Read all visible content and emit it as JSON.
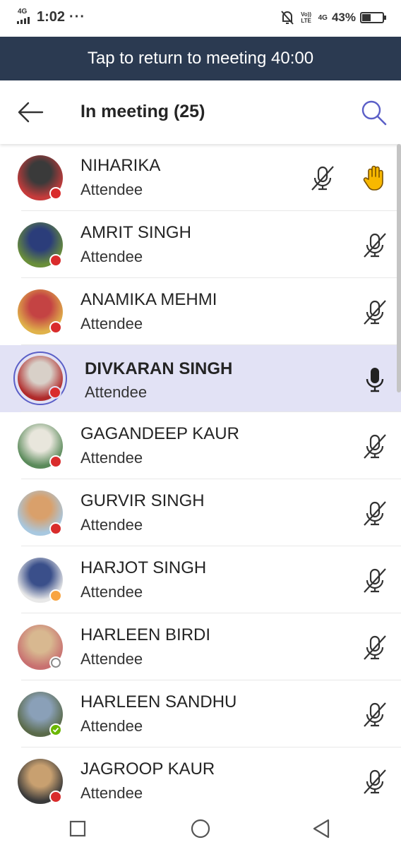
{
  "status_bar": {
    "network": "4G",
    "time": "1:02",
    "more": "···",
    "volte": "Vo)) LTE",
    "net2": "4G",
    "battery_pct": "43%",
    "battery_level": 0.43,
    "icons": [
      "mute-bell-icon",
      "signal-icon",
      "battery-icon"
    ]
  },
  "banner": {
    "text": "Tap to return to meeting 40:00"
  },
  "header": {
    "title": "In meeting (25)",
    "back_icon": "arrow-left-icon",
    "search_icon": "search-icon"
  },
  "participants": [
    {
      "name": "NIHARIKA",
      "role": "Attendee",
      "status": "busy",
      "mic": "muted",
      "raised_hand": true,
      "avatar_colors": [
        "#3a3a3a",
        "#c63b3b"
      ]
    },
    {
      "name": "AMRIT SINGH",
      "role": "Attendee",
      "status": "busy",
      "mic": "muted",
      "raised_hand": false,
      "avatar_colors": [
        "#2b3d7a",
        "#6a8f3a"
      ]
    },
    {
      "name": "ANAMIKA MEHMI",
      "role": "Attendee",
      "status": "busy",
      "mic": "muted",
      "raised_hand": false,
      "avatar_colors": [
        "#c44343",
        "#e0b24a"
      ]
    },
    {
      "name": "DIVKARAN SINGH",
      "role": "Attendee",
      "status": "busy",
      "mic": "speaking",
      "raised_hand": false,
      "active": true,
      "avatar_colors": [
        "#d8d0c8",
        "#b02a2a"
      ]
    },
    {
      "name": "GAGANDEEP KAUR",
      "role": "Attendee",
      "status": "busy",
      "mic": "muted",
      "raised_hand": false,
      "avatar_colors": [
        "#e8e6dc",
        "#5a8a5a"
      ]
    },
    {
      "name": "GURVIR SINGH",
      "role": "Attendee",
      "status": "busy",
      "mic": "muted",
      "raised_hand": false,
      "avatar_colors": [
        "#d9a06b",
        "#a8c8e0"
      ]
    },
    {
      "name": "HARJOT SINGH",
      "role": "Attendee",
      "status": "away",
      "mic": "muted",
      "raised_hand": false,
      "avatar_colors": [
        "#3a4f8a",
        "#e8e8e8"
      ]
    },
    {
      "name": "HARLEEN BIRDI",
      "role": "Attendee",
      "status": "offline",
      "mic": "muted",
      "raised_hand": false,
      "avatar_colors": [
        "#d8b890",
        "#c87070"
      ]
    },
    {
      "name": "HARLEEN SANDHU",
      "role": "Attendee",
      "status": "available",
      "mic": "muted",
      "raised_hand": false,
      "avatar_colors": [
        "#8aa0b8",
        "#5a6a4a"
      ]
    },
    {
      "name": "JAGROOP KAUR",
      "role": "Attendee",
      "status": "busy",
      "mic": "muted",
      "raised_hand": false,
      "avatar_colors": [
        "#c8a070",
        "#3a3a3a"
      ]
    }
  ],
  "status_colors": {
    "busy": "#d92c2c",
    "away": "#f8a442",
    "available": "#6bb700",
    "offline": "#ffffff"
  },
  "colors": {
    "banner_bg": "#2b3a51",
    "accent": "#5b5fc7",
    "active_row": "#e2e2f5",
    "raised_hand": "#f8b800"
  },
  "navbar": {
    "icons": [
      "recent-apps-icon",
      "home-icon",
      "back-triangle-icon"
    ]
  }
}
